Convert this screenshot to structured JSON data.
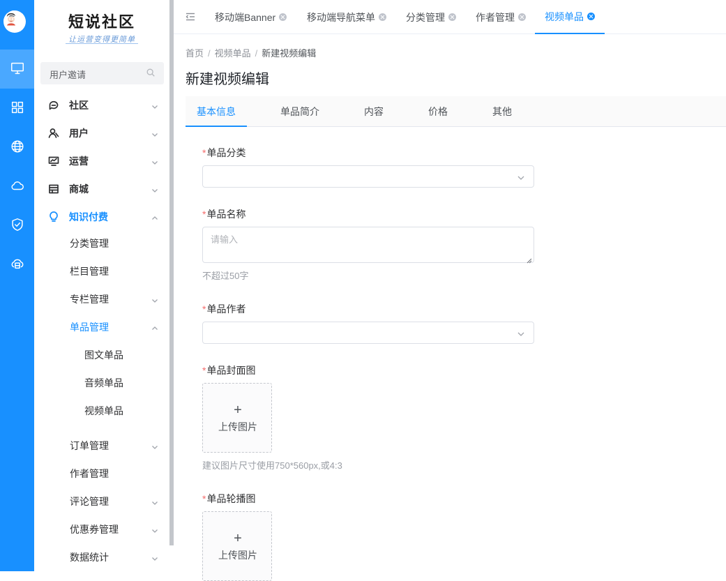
{
  "brand": {
    "title": "短说社区",
    "subtitle": "让运营变得更简单"
  },
  "search": {
    "text": "用户邀请"
  },
  "menu": {
    "community": "社区",
    "users": "用户",
    "operations": "运营",
    "mall": "商城",
    "knowledge": "知识付费",
    "knowledge_children": {
      "category": "分类管理",
      "column": "栏目管理",
      "special": "专栏管理",
      "item": "单品管理",
      "item_children": {
        "article": "图文单品",
        "audio": "音频单品",
        "video": "视频单品"
      },
      "orders": "订单管理",
      "authors": "作者管理",
      "comments": "评论管理",
      "coupons": "优惠券管理",
      "stats": "数据统计"
    }
  },
  "page_tabs": [
    "移动端Banner",
    "移动端导航菜单",
    "分类管理",
    "作者管理",
    "视频单品"
  ],
  "breadcrumb": {
    "home": "首页",
    "section": "视频单品",
    "current": "新建视频编辑"
  },
  "page_title": "新建视频编辑",
  "form_tabs": [
    "基本信息",
    "单品简介",
    "内容",
    "价格",
    "其他"
  ],
  "form": {
    "category_label": "单品分类",
    "name_label": "单品名称",
    "name_placeholder": "请输入",
    "name_hint": "不超过50字",
    "author_label": "单品作者",
    "cover_label": "单品封面图",
    "upload_text": "上传图片",
    "cover_hint": "建议图片尺寸使用750*560px,或4:3",
    "carousel_label": "单品轮播图",
    "required_mark": "*"
  },
  "colors": {
    "primary": "#1890ff",
    "rail_active": "#4aa8ff",
    "required": "#f56c6c"
  }
}
